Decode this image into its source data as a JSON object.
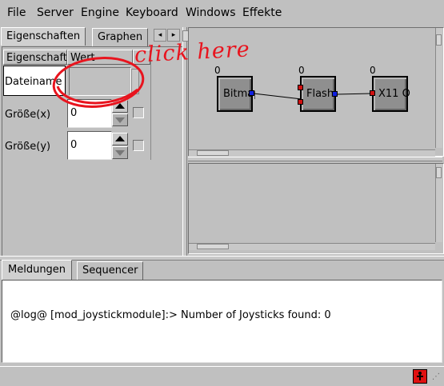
{
  "menu": [
    "File",
    "Server",
    "Engine",
    "Keyboard",
    "Windows",
    "Effekte"
  ],
  "left_tabs": [
    "Eigenschaften",
    "Graphen"
  ],
  "prop_table": {
    "headers": [
      "Eigenschaft",
      "Wert"
    ],
    "rows": [
      {
        "label": "Dateiname",
        "value": ""
      },
      {
        "label": "Größe(x)",
        "value": "0"
      },
      {
        "label": "Größe(y)",
        "value": "0"
      }
    ]
  },
  "annotation": "click here",
  "graph": {
    "nodes": [
      {
        "label": "Bitmap",
        "count": "0"
      },
      {
        "label": "Flash",
        "count": "0"
      },
      {
        "label": "X11 O",
        "count": "0"
      }
    ]
  },
  "bottom_tabs": [
    "Meldungen",
    "Sequencer"
  ],
  "log_message": "@log@ [mod_joystickmodule]:> Number of Joysticks found: 0",
  "colors": {
    "background": "#c0c0c0",
    "annotation_red": "#e8141e",
    "port_blue": "#1020e0",
    "port_red": "#d01010"
  },
  "icons": [
    "status-warning-icon"
  ]
}
